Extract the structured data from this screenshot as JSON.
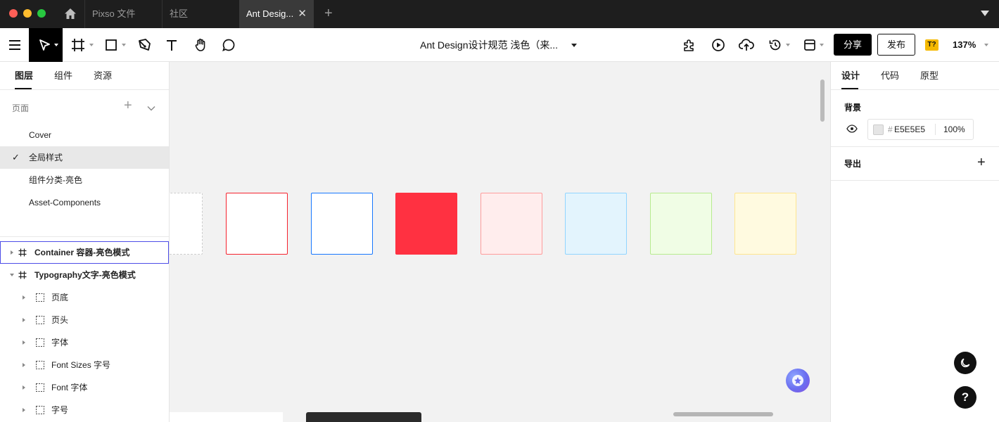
{
  "tabs": [
    {
      "label": "Pixso 文件"
    },
    {
      "label": "社区"
    },
    {
      "label": "Ant Desig...",
      "close": "✕"
    }
  ],
  "tab_plus": "+",
  "toolbar": {
    "doc_title": "Ant Design设计规范 浅色（来...",
    "share_label": "分享",
    "publish_label": "发布",
    "avatar": "T?",
    "zoom": "137%"
  },
  "left_panel": {
    "tabs": [
      "图层",
      "组件",
      "资源"
    ],
    "pages_label": "页面",
    "add_page": "+",
    "pages": [
      "Cover",
      "全局样式",
      "组件分类-亮色",
      "Asset-Components"
    ],
    "selected_page_check": "✓",
    "layers": [
      {
        "label": "Container 容器-亮色模式"
      },
      {
        "label": "Typography文字-亮色模式"
      },
      {
        "label": "页底"
      },
      {
        "label": "页头"
      },
      {
        "label": "字体"
      },
      {
        "label": "Font Sizes 字号"
      },
      {
        "label": "Font 字体"
      },
      {
        "label": "字号"
      }
    ]
  },
  "canvas": {
    "swatches": [
      {
        "fill": "#ffffff",
        "border": "#cccccc",
        "dashed": true
      },
      {
        "fill": "#ffffff",
        "border": "#f5222d"
      },
      {
        "fill": "#ffffff",
        "border": "#1677ff"
      },
      {
        "fill": "#ff3141",
        "border": "#ff3141"
      },
      {
        "fill": "#ffeded",
        "border": "#ff9c9c"
      },
      {
        "fill": "#e3f4fd",
        "border": "#91d5ff"
      },
      {
        "fill": "#f0fde5",
        "border": "#b7eb8f"
      },
      {
        "fill": "#fffae0",
        "border": "#ffe58f"
      }
    ]
  },
  "right_panel": {
    "tabs": [
      "设计",
      "代码",
      "原型"
    ],
    "background_label": "背景",
    "hash": "#",
    "bg_hex": "E5E5E5",
    "bg_opacity": "100%",
    "export_label": "导出",
    "export_add": "+",
    "help": "?"
  }
}
